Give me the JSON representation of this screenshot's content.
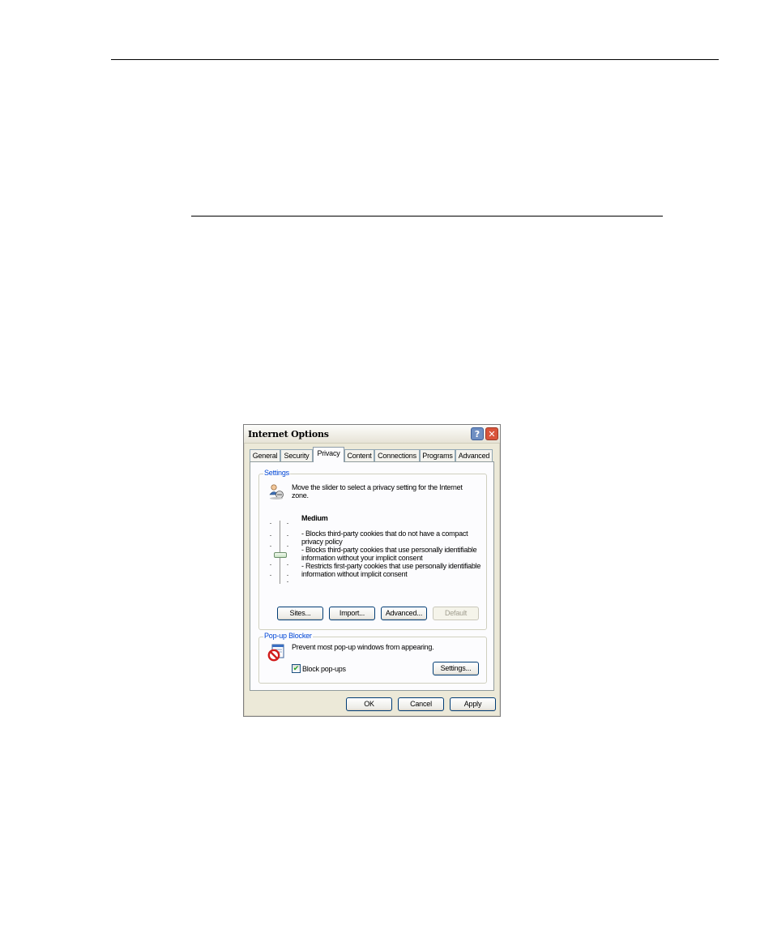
{
  "window": {
    "title": "Internet Options",
    "help_glyph": "?",
    "close_glyph": "✕"
  },
  "tabs": [
    {
      "label": "General"
    },
    {
      "label": "Security"
    },
    {
      "label": "Privacy",
      "selected": true
    },
    {
      "label": "Content"
    },
    {
      "label": "Connections"
    },
    {
      "label": "Programs"
    },
    {
      "label": "Advanced"
    }
  ],
  "settings": {
    "legend": "Settings",
    "instruction_line1": "Move the slider to select a privacy setting for the Internet",
    "instruction_line2": "zone.",
    "level": "Medium",
    "slider_level": "Medium",
    "desc": [
      "- Blocks third-party cookies that do not have a compact",
      "privacy policy",
      "- Blocks third-party cookies that use personally identifiable",
      "information without your implicit consent",
      "- Restricts first-party cookies that use personally identifiable",
      "information without implicit consent"
    ],
    "buttons": {
      "sites": "Sites...",
      "import": "Import...",
      "advanced": "Advanced...",
      "default": "Default"
    }
  },
  "popup": {
    "legend": "Pop-up Blocker",
    "description": "Prevent most pop-up windows from appearing.",
    "checkbox_label": "Block pop-ups",
    "checkbox_checked": true,
    "checkbox_glyph": "✔",
    "settings_button": "Settings..."
  },
  "footer": {
    "ok": "OK",
    "cancel": "Cancel",
    "apply": "Apply"
  }
}
